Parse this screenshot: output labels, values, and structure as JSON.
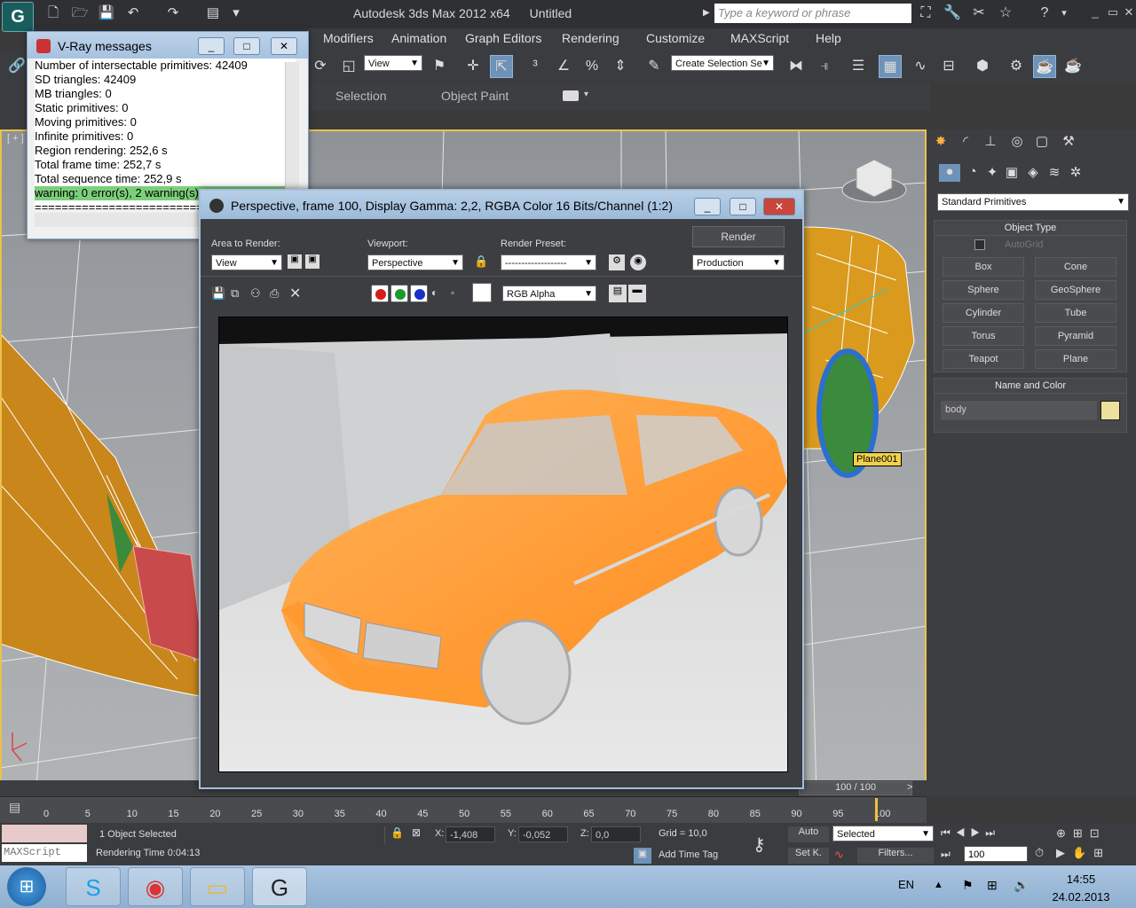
{
  "app": {
    "logo": "G",
    "title": "Autodesk 3ds Max  2012 x64",
    "doc": "Untitled",
    "search_placeholder": "Type a keyword or phrase"
  },
  "menu": [
    "Modifiers",
    "Animation",
    "Graph Editors",
    "Rendering",
    "Customize",
    "MAXScript",
    "Help"
  ],
  "toolbar": {
    "view_combo": "View",
    "selection_set": "Create Selection Se"
  },
  "ribbon": {
    "tabs": [
      "Selection",
      "Object Paint"
    ]
  },
  "viewport": {
    "label": "[ + ]",
    "plane_label": "Plane001",
    "cube": "TOP"
  },
  "vray": {
    "title": "V-Ray messages",
    "lines": [
      "Number of intersectable primitives: 42409",
      "  SD triangles: 42409",
      "  MB triangles: 0",
      "  Static primitives: 0",
      "  Moving primitives: 0",
      "  Infinite primitives: 0",
      "Region rendering: 252,6 s",
      "Total frame time: 252,7 s",
      "Total sequence time: 252,9 s"
    ],
    "warning": "warning: 0 error(s), 2 warning(s)",
    "separator": "================================"
  },
  "framebuffer": {
    "title": "Perspective, frame 100, Display Gamma: 2,2, RGBA Color 16 Bits/Channel (1:2)",
    "area_label": "Area to Render:",
    "area_value": "View",
    "viewport_label": "Viewport:",
    "viewport_value": "Perspective",
    "preset_label": "Render Preset:",
    "preset_value": "-------------------",
    "render_button": "Render",
    "production": "Production",
    "channel": "RGB Alpha"
  },
  "cmdpanel": {
    "category": "Standard Primitives",
    "object_type": "Object Type",
    "autogrid": "AutoGrid",
    "primitives": [
      "Box",
      "Cone",
      "Sphere",
      "GeoSphere",
      "Cylinder",
      "Tube",
      "Torus",
      "Pyramid",
      "Teapot",
      "Plane"
    ],
    "name_color": "Name and Color",
    "name_value": "body",
    "name_color_hex": "#eee09c"
  },
  "timeline": {
    "frame": "100 / 100",
    "ticks": [
      "0",
      "5",
      "10",
      "15",
      "20",
      "25",
      "30",
      "35",
      "40",
      "45",
      "50",
      "55",
      "60",
      "65",
      "70",
      "75",
      "80",
      "85",
      "90",
      "95",
      "100"
    ]
  },
  "status": {
    "selected": "1 Object Selected",
    "render_time": "Rendering Time  0:04:13",
    "maxscript": "MAXScript",
    "x_label": "X:",
    "x": "-1,408",
    "y_label": "Y:",
    "y": "-0,052",
    "z_label": "Z:",
    "z": "0,0",
    "grid": "Grid = 10,0",
    "add_tag": "Add Time Tag",
    "auto": "Auto",
    "selected_combo": "Selected",
    "setk": "Set K.",
    "filters": "Filters...",
    "frame_field": "100"
  },
  "taskbar": {
    "lang": "EN",
    "time": "14:55",
    "date": "24.02.2013"
  }
}
